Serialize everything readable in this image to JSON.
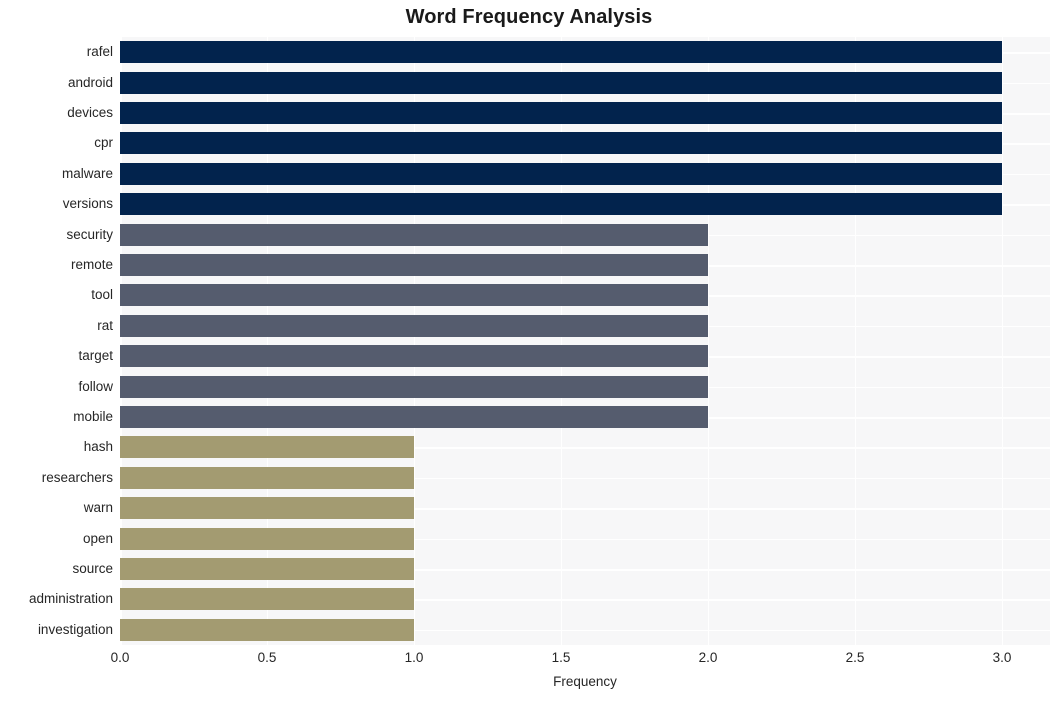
{
  "chart_data": {
    "type": "bar",
    "orientation": "horizontal",
    "title": "Word Frequency Analysis",
    "xlabel": "Frequency",
    "ylabel": "",
    "xlim": [
      0,
      3.1633
    ],
    "xticks": [
      0,
      0.5,
      1,
      1.5,
      2,
      2.5,
      3
    ],
    "xticklabels": [
      "0.0",
      "0.5",
      "1.0",
      "1.5",
      "2.0",
      "2.5",
      "3.0"
    ],
    "grid": true,
    "legend": null,
    "categories": [
      "rafel",
      "android",
      "devices",
      "cpr",
      "malware",
      "versions",
      "security",
      "remote",
      "tool",
      "rat",
      "target",
      "follow",
      "mobile",
      "hash",
      "researchers",
      "warn",
      "open",
      "source",
      "administration",
      "investigation"
    ],
    "values": [
      3,
      3,
      3,
      3,
      3,
      3,
      2,
      2,
      2,
      2,
      2,
      2,
      2,
      1,
      1,
      1,
      1,
      1,
      1,
      1
    ],
    "bar_colors": [
      "#02234d",
      "#02234d",
      "#02234d",
      "#02234d",
      "#02234d",
      "#02234d",
      "#555c6e",
      "#555c6e",
      "#555c6e",
      "#555c6e",
      "#555c6e",
      "#555c6e",
      "#555c6e",
      "#a39b71",
      "#a39b71",
      "#a39b71",
      "#a39b71",
      "#a39b71",
      "#a39b71",
      "#a39b71"
    ]
  },
  "style": {
    "plot_background": "#f7f7f8",
    "figure_background": "#ffffff",
    "gridline_color": "#ffffff",
    "text_color": "#262626",
    "color_high": "#02234d",
    "color_mid": "#555c6e",
    "color_low": "#a39b71"
  }
}
